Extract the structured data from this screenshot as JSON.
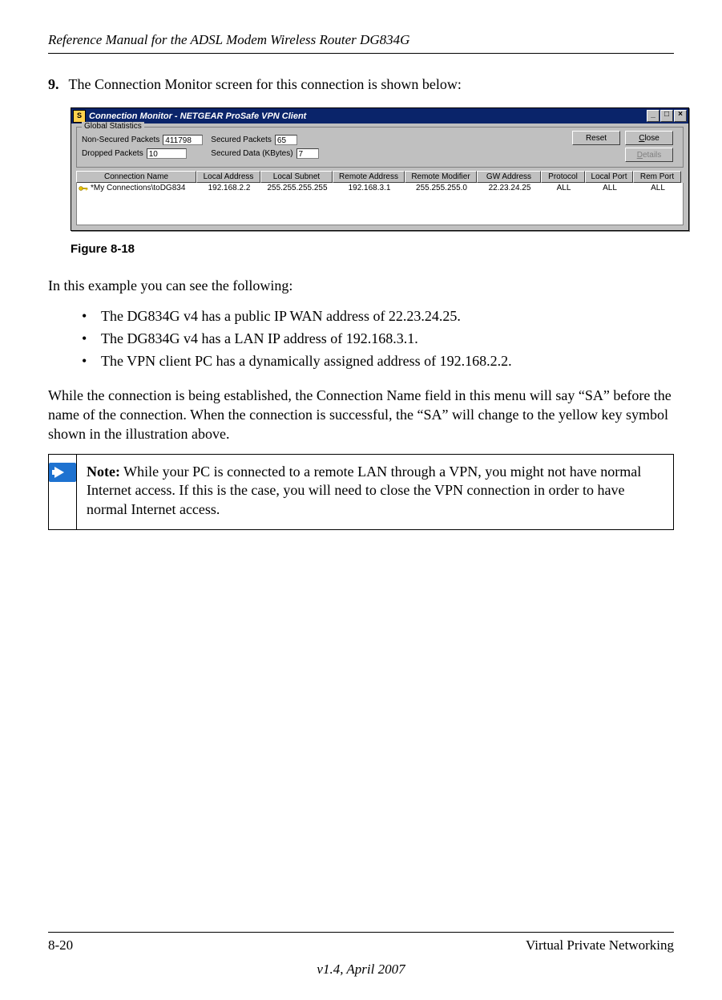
{
  "header": {
    "title": "Reference Manual for the ADSL Modem Wireless Router DG834G"
  },
  "step": {
    "number": "9.",
    "text": "The Connection Monitor screen for this connection is shown below:"
  },
  "window": {
    "title": "Connection Monitor - NETGEAR ProSafe VPN Client",
    "icon_letter": "S",
    "stats_legend": "Global Statistics",
    "labels": {
      "non_secured": "Non-Secured Packets",
      "dropped": "Dropped Packets",
      "secured_pkts": "Secured Packets",
      "secured_data": "Secured Data (KBytes)"
    },
    "values": {
      "non_secured": "411798",
      "dropped": "10",
      "secured_pkts": "65",
      "secured_data": "7"
    },
    "buttons": {
      "reset": "Reset",
      "close": "Close",
      "details": "Details"
    },
    "grid": {
      "headers": [
        "Connection Name",
        "Local Address",
        "Local Subnet",
        "Remote Address",
        "Remote Modifier",
        "GW Address",
        "Protocol",
        "Local Port",
        "Rem Port"
      ],
      "row": {
        "name": "*My Connections\\toDG834",
        "local_addr": "192.168.2.2",
        "local_sub": "255.255.255.255",
        "remote_addr": "192.168.3.1",
        "remote_mod": "255.255.255.0",
        "gw": "22.23.24.25",
        "proto": "ALL",
        "lport": "ALL",
        "rport": "ALL"
      }
    }
  },
  "figure_label": "Figure 8-18",
  "intro_para": "In this example you can see the following:",
  "bullets": [
    "The DG834G v4 has a public IP WAN address of 22.23.24.25.",
    "The DG834G v4 has a LAN IP address of 192.168.3.1.",
    "The VPN client PC has a dynamically assigned address of 192.168.2.2."
  ],
  "conn_para": "While the connection is being established, the Connection Name field in this menu will say “SA” before the name of the connection. When the connection is successful, the “SA” will change to the yellow key symbol shown in the illustration above.",
  "note": {
    "prefix": "Note:",
    "text": " While your PC is connected to a remote LAN through a VPN, you might not have normal Internet access. If this is the case, you will need to close the VPN connection in order to have normal Internet access."
  },
  "footer": {
    "page": "8-20",
    "section": "Virtual Private Networking",
    "version": "v1.4, April 2007"
  }
}
